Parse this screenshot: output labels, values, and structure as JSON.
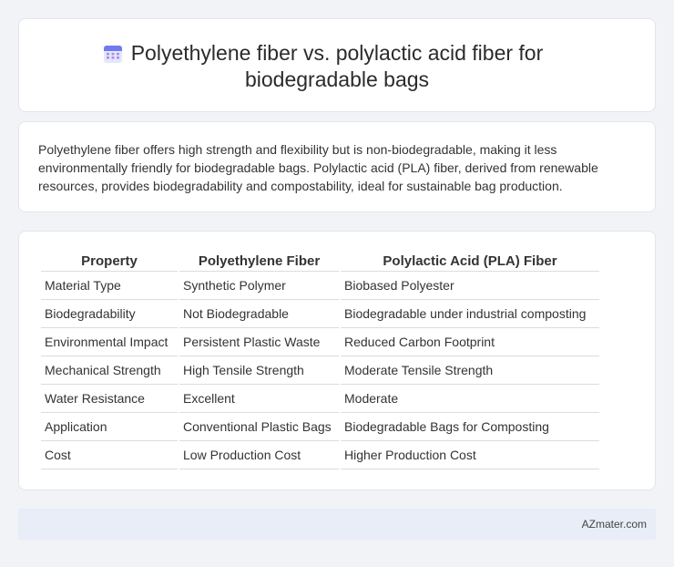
{
  "header": {
    "title_line1": "Polyethylene fiber vs. polylactic acid fiber for",
    "title_line2": "biodegradable bags",
    "icon": "calendar-icon"
  },
  "summary": {
    "text": "Polyethylene fiber offers high strength and flexibility but is non-biodegradable, making it less environmentally friendly for biodegradable bags. Polylactic acid (PLA) fiber, derived from renewable resources, provides biodegradability and compostability, ideal for sustainable bag production."
  },
  "table": {
    "headers": [
      "Property",
      "Polyethylene Fiber",
      "Polylactic Acid (PLA) Fiber"
    ],
    "rows": [
      [
        "Material Type",
        "Synthetic Polymer",
        "Biobased Polyester"
      ],
      [
        "Biodegradability",
        "Not Biodegradable",
        "Biodegradable under industrial composting"
      ],
      [
        "Environmental Impact",
        "Persistent Plastic Waste",
        "Reduced Carbon Footprint"
      ],
      [
        "Mechanical Strength",
        "High Tensile Strength",
        "Moderate Tensile Strength"
      ],
      [
        "Water Resistance",
        "Excellent",
        "Moderate"
      ],
      [
        "Application",
        "Conventional Plastic Bags",
        "Biodegradable Bags for Composting"
      ],
      [
        "Cost",
        "Low Production Cost",
        "Higher Production Cost"
      ]
    ]
  },
  "footer": {
    "brand": "AZmater.com"
  }
}
